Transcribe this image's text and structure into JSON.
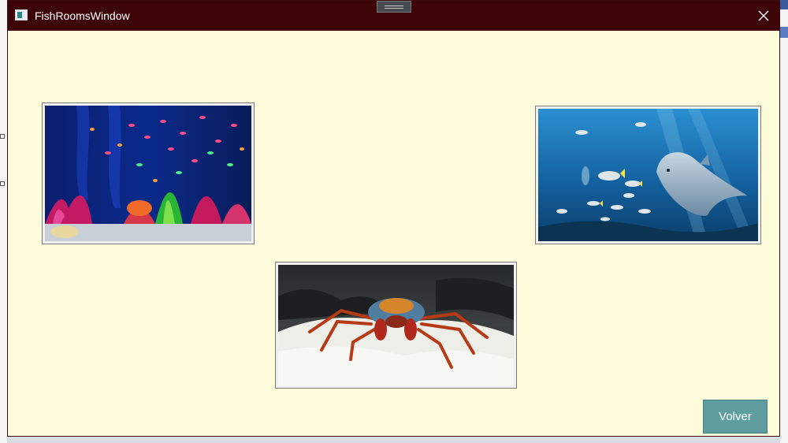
{
  "window": {
    "title": "FishRoomsWindow",
    "close_icon": "close-icon",
    "app_icon": "window-app-icon"
  },
  "rooms": [
    {
      "name": "aquarium",
      "description_icon": "aquarium-image"
    },
    {
      "name": "ocean",
      "description_icon": "dolphin-image"
    },
    {
      "name": "crab",
      "description_icon": "crab-image"
    }
  ],
  "actions": {
    "back_label": "Volver"
  },
  "colors": {
    "titlebar": "#3d0407",
    "background": "#fffcdb",
    "button": "#5e9ea0"
  }
}
